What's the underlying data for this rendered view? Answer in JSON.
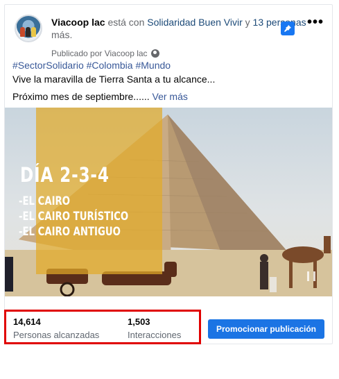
{
  "post": {
    "page_name": "Viacoop lac",
    "connector": " está con ",
    "tagged": "Solidaridad Buen Vivir",
    "and_text": " y ",
    "others": "13 personas",
    "more": " más.",
    "published_by": "Publicado por Viacoop lac",
    "hashtags": [
      "#SectorSolidario",
      "#Colombia",
      "#Mundo"
    ],
    "line1": "Vive la maravilla de Tierra Santa a tu alcance...",
    "line2": "Próximo mes de septiembre...... ",
    "see_more": "Ver más"
  },
  "media": {
    "title": "DÍA 2-3-4",
    "items": [
      "-EL CAIRO",
      "-EL CAIRO TURÍSTICO",
      "-EL CAIRO ANTIGUO"
    ]
  },
  "stats": {
    "reach_value": "14,614",
    "reach_label": "Personas alcanzadas",
    "interactions_value": "1,503",
    "interactions_label": "Interacciones"
  },
  "actions": {
    "promote_label": "Promocionar publicación"
  },
  "icons": {
    "pin": "pin-icon",
    "more": "more-options-icon",
    "globe": "globe-icon"
  },
  "colors": {
    "accent": "#1b74e4",
    "link": "#385898",
    "highlight_border": "#e00000",
    "overlay": "#e2aa28"
  }
}
